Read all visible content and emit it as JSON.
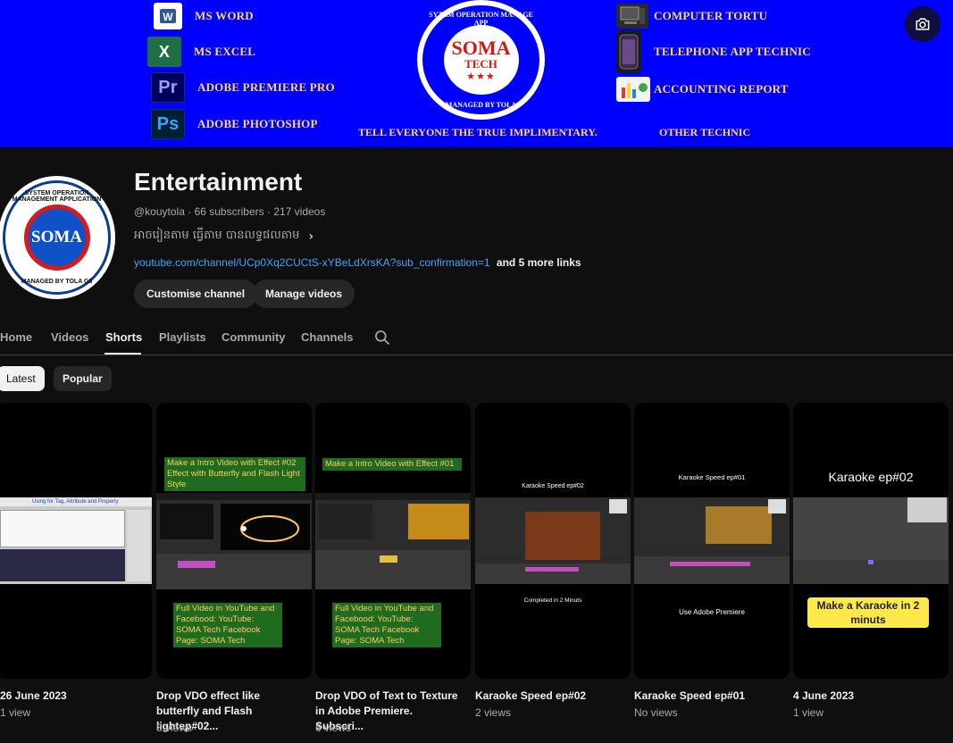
{
  "banner": {
    "left_apps": [
      {
        "label": "MS WORD",
        "icon": "ms-word-icon"
      },
      {
        "label": "MS EXCEL",
        "icon": "ms-excel-icon"
      },
      {
        "label": "ADOBE PREMIERE PRO",
        "icon": "adobe-premiere-icon"
      },
      {
        "label": "ADOBE PHOTOSHOP",
        "icon": "adobe-photoshop-icon"
      }
    ],
    "right_apps": [
      {
        "label": "COMPUTER TORTU",
        "icon": "computer-icon"
      },
      {
        "label": "TELEPHONE APP TECHNIC",
        "icon": "phone-icon"
      },
      {
        "label": "ACCOUNTING REPORT",
        "icon": "accounting-icon"
      }
    ],
    "logo": {
      "ring_top": "SYTEM OPERATION MANAGE APP",
      "ring_bottom": "MANAGED BY TOLA",
      "name": "SOMA",
      "sub": "TECH",
      "stars": "★★★"
    },
    "tagline": "TELL EVERYONE THE TRUE IMPLIMENTARY.",
    "other": "OTHER TECHNIC",
    "bg_color": "#0000ff",
    "text_color": "#ffd95a"
  },
  "avatar": {
    "ring_top": "SYSTEM OPERATION MANAGEMENT APPLICATION",
    "ring_bottom": "MANAGED BY TOLA G8",
    "name": "SOMA"
  },
  "channel": {
    "title": "Entertainment",
    "handle": "@kouytola",
    "subscribers": "66 subscribers",
    "videos": "217 videos",
    "description": "អាចរៀនតាម ធ្វើតាម បានលទ្ធផលតាម",
    "link": "youtube.com/channel/UCp0Xq2CUCtS-xYBeLdXrsKA?sub_confirmation=1",
    "more_links": "and 5 more links",
    "customise_label": "Customise channel",
    "manage_label": "Manage videos",
    "link_color": "#3ea6ff"
  },
  "tabs": [
    "Home",
    "Videos",
    "Shorts",
    "Playlists",
    "Community",
    "Channels"
  ],
  "active_tab": "Shorts",
  "chips": {
    "latest": "Latest",
    "popular": "Popular",
    "selected": "Latest"
  },
  "shorts": [
    {
      "title": "26 June 2023",
      "views": "1 view",
      "caption": "Using for Tag, Attribute and Property"
    },
    {
      "title": "Drop VDO effect like butterfly and Flash lightep#02...",
      "views": "8 views",
      "caption_top": "Make a Intro Video with Effect #02 Effect with Butterfly and Flash Light Style",
      "caption_bottom": "Full Video in YouTube and Facebood: YouTube: SOMA Tech Facebook Page: SOMA Tech"
    },
    {
      "title": "Drop VDO of Text to Texture in Adobe Premiere. Subscri...",
      "views": "6 views",
      "caption_top": "Make a Intro Video with Effect #01",
      "caption_bottom": "Full Video in YouTube and Facebood: YouTube: SOMA Tech Facebook Page: SOMA Tech"
    },
    {
      "title": "Karaoke Speed ep#02",
      "views": "2 views",
      "caption_top": "Karaoke Speed ep#02",
      "caption_bottom": "Completed in 2 Minuts"
    },
    {
      "title": "Karaoke Speed ep#01",
      "views": "No views",
      "caption_top": "Karaoke Speed ep#01",
      "caption_bottom": "Use Adobe Premiere"
    },
    {
      "title": "4 June 2023",
      "views": "1 view",
      "caption_top": "Karaoke ep#02",
      "caption_bottom": "Make a Karaoke in 2 minuts"
    }
  ]
}
